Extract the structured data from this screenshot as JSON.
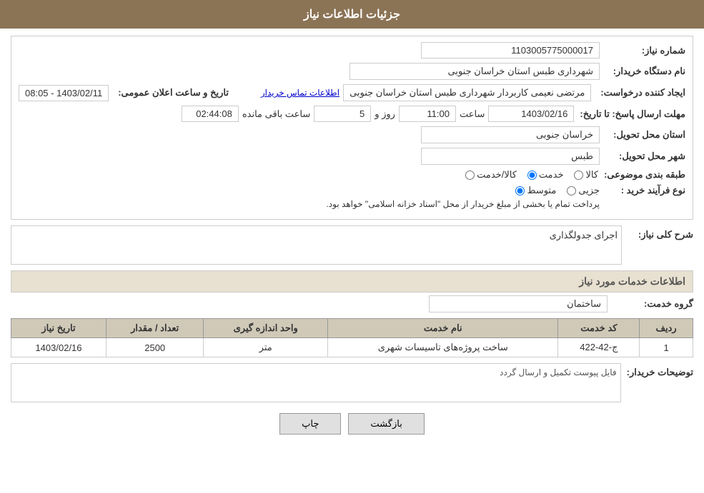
{
  "header": {
    "title": "جزئیات اطلاعات نیاز"
  },
  "fields": {
    "shomareNiaz_label": "شماره نیاز:",
    "shomareNiaz_value": "1103005775000017",
    "namdastgah_label": "نام دستگاه خریدار:",
    "namdastgah_value": "شهرداری طبس استان خراسان جنوبی",
    "ejad_label": "ایجاد کننده درخواست:",
    "ejad_value": "مرتضی نعیمی کاربردار شهرداری طبس استان خراسان جنوبی",
    "ejad_link": "اطلاعات تماس خریدار",
    "mohlatErsal_label": "مهلت ارسال پاسخ: تا تاریخ:",
    "mohlatDate": "1403/02/16",
    "mohlatSaat_label": "ساعت",
    "mohlatSaat": "11:00",
    "mohlatRooz_label": "روز و",
    "mohlatRooz": "5",
    "mohlatBaqi_label": "ساعت باقی مانده",
    "mohlatBaqi": "02:44:08",
    "ostanTahvil_label": "استان محل تحویل:",
    "ostanTahvil_value": "خراسان جنوبی",
    "shahrTahvil_label": "شهر محل تحویل:",
    "shahrTahvil_value": "طبس",
    "tarixAelan_label": "تاریخ و ساعت اعلان عمومی:",
    "tarixAelan_value": "1403/02/11 - 08:05",
    "tabaqeBandi_label": "طبقه بندی موضوعی:",
    "radio_kala": "کالا",
    "radio_khedmat": "خدمت",
    "radio_kala_khedmat": "کالا/خدمت",
    "radio_kala_checked": false,
    "radio_khedmat_checked": true,
    "radio_kala_khedmat_checked": false,
    "noeFarayand_label": "نوع فرآیند خرید :",
    "noeFarayand_jozyi": "جزیی",
    "noeFarayand_motevasset": "متوسط",
    "noeFarayand_text": "پرداخت تمام یا بخشی از مبلغ خریدار از محل \"اسناد خزانه اسلامی\" خواهد بود.",
    "sharhKoli_label": "شرح کلی نیاز:",
    "sharhKoli_value": "اجرای جدولگذاری",
    "khadamat_section_title": "اطلاعات خدمات مورد نیاز",
    "groupKhedmat_label": "گروه خدمت:",
    "groupKhedmat_value": "ساختمان",
    "table_headers": [
      "ردیف",
      "کد خدمت",
      "نام خدمت",
      "واحد اندازه گیری",
      "تعداد / مقدار",
      "تاریخ نیاز"
    ],
    "table_rows": [
      {
        "radif": "1",
        "kodKhedmat": "ج-42-422",
        "namKhedmat": "ساخت پروژه‌های تاسیسات شهری",
        "vahed": "متر",
        "tedad": "2500",
        "tarixNiaz": "1403/02/16"
      }
    ],
    "tosifKharidar_label": "توضیحات خریدار:",
    "tosifKharidar_value": "فایل پیوست تکمیل و ارسال گردد",
    "btn_chap": "چاپ",
    "btn_bazgasht": "بازگشت"
  }
}
